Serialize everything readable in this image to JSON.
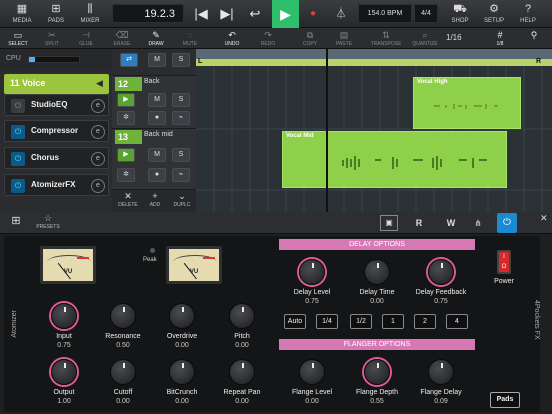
{
  "topbar": {
    "media": "MEDIA",
    "pads": "PADS",
    "mixer": "MIXER",
    "position": "19.2.3",
    "tempo": "154.0 BPM",
    "signature": "4/4",
    "shop": "SHOP",
    "setup": "SETUP",
    "help": "HELP"
  },
  "toolbar": {
    "select": "SELECT",
    "split": "SPLIT",
    "glue": "GLUE",
    "erase": "ERASE",
    "draw": "DRAW",
    "mute": "MUTE",
    "undo": "UNDO",
    "redo": "REDO",
    "copy": "COPY",
    "paste": "PASTE",
    "transpose": "TRANSPOSE",
    "quantize": "QUANTIZE",
    "grid_value": "1/16",
    "grid_sub": "1/8"
  },
  "left": {
    "cpu_label": "CPU",
    "cpu_level": 0.12,
    "voice_label": "11  Voice",
    "fx": [
      {
        "name": "StudioEQ",
        "on": false
      },
      {
        "name": "Compressor",
        "on": true
      },
      {
        "name": "Chorus",
        "on": true
      },
      {
        "name": "AtomizerFX",
        "on": true
      }
    ]
  },
  "tracks": [
    {
      "num": "12",
      "name": "Back"
    },
    {
      "num": "13",
      "name": "Back mid"
    }
  ],
  "clips": [
    {
      "name": "Vocal High"
    },
    {
      "name": "Vocal Mid"
    }
  ],
  "ruler": {
    "left_marker": "L",
    "right_marker": "R"
  },
  "edit_bar": {
    "delete": "DELETE",
    "add": "ADD",
    "duplicate": "DUPLC"
  },
  "plugin": {
    "presets_label": "PRESETS",
    "name_left": "Atomizer",
    "name_right": "4Pockets FX",
    "vu_label": "VU",
    "peak_label": "Peak",
    "knobs": [
      {
        "label": "Input",
        "value": "0.75"
      },
      {
        "label": "Resonance",
        "value": "0.50"
      },
      {
        "label": "Overdrive",
        "value": "0.00"
      },
      {
        "label": "Pitch",
        "value": "0.00"
      },
      {
        "label": "Output",
        "value": "1.00"
      },
      {
        "label": "Cutoff",
        "value": "0.00"
      },
      {
        "label": "BitCrunch",
        "value": "0.00"
      },
      {
        "label": "Repeat Pan",
        "value": "0.00"
      }
    ],
    "delay_header": "DELAY OPTIONS",
    "delay_knobs": [
      {
        "label": "Delay Level",
        "value": "0.75"
      },
      {
        "label": "Delay Time",
        "value": "0.00"
      },
      {
        "label": "Delay Feedback",
        "value": "0.75"
      }
    ],
    "delay_buttons": [
      "Auto",
      "1/4",
      "1/2",
      "1",
      "2",
      "4"
    ],
    "flanger_header": "FLANGER OPTIONS",
    "flanger_knobs": [
      {
        "label": "Flange Level",
        "value": "0.00"
      },
      {
        "label": "Flange Depth",
        "value": "0.55"
      },
      {
        "label": "Flange Delay",
        "value": "0.09"
      }
    ],
    "power_label": "Power",
    "pads_button": "Pads"
  },
  "colors": {
    "accent_green": "#2fbf6a",
    "clip_green": "#8fd04a",
    "section_pink": "#d678b4",
    "power_blue": "#5fd0ff"
  }
}
